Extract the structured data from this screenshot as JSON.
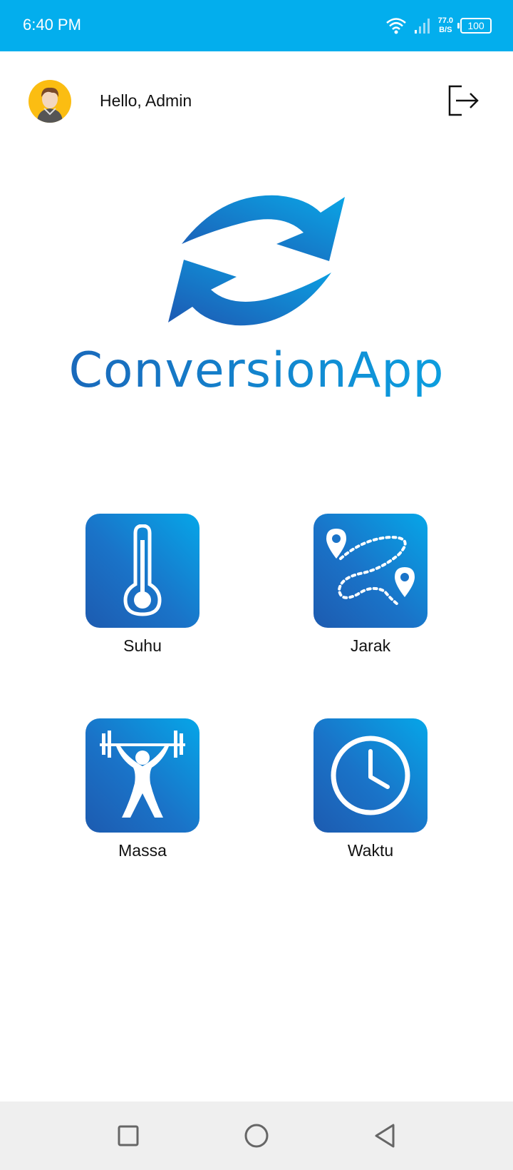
{
  "status_bar": {
    "time": "6:40 PM",
    "net_speed_value": "77.0",
    "net_speed_unit": "B/S",
    "battery": "100",
    "background_color": "#03aeed"
  },
  "header": {
    "greeting": "Hello, Admin",
    "avatar_icon": "user-avatar",
    "logout_icon": "logout-icon"
  },
  "logo": {
    "icon": "refresh-arrows-icon",
    "text": "ConversionApp"
  },
  "menu": {
    "items": [
      {
        "label": "Suhu",
        "icon": "thermometer-icon"
      },
      {
        "label": "Jarak",
        "icon": "route-map-icon"
      },
      {
        "label": "Massa",
        "icon": "weightlifter-icon"
      },
      {
        "label": "Waktu",
        "icon": "clock-icon"
      }
    ]
  },
  "nav_bar": {
    "recent_icon": "square-icon",
    "home_icon": "circle-icon",
    "back_icon": "triangle-back-icon"
  },
  "colors": {
    "accent": "#03aeed",
    "tile_dark": "#1d5bb0",
    "tile_light": "#06a6e8"
  }
}
